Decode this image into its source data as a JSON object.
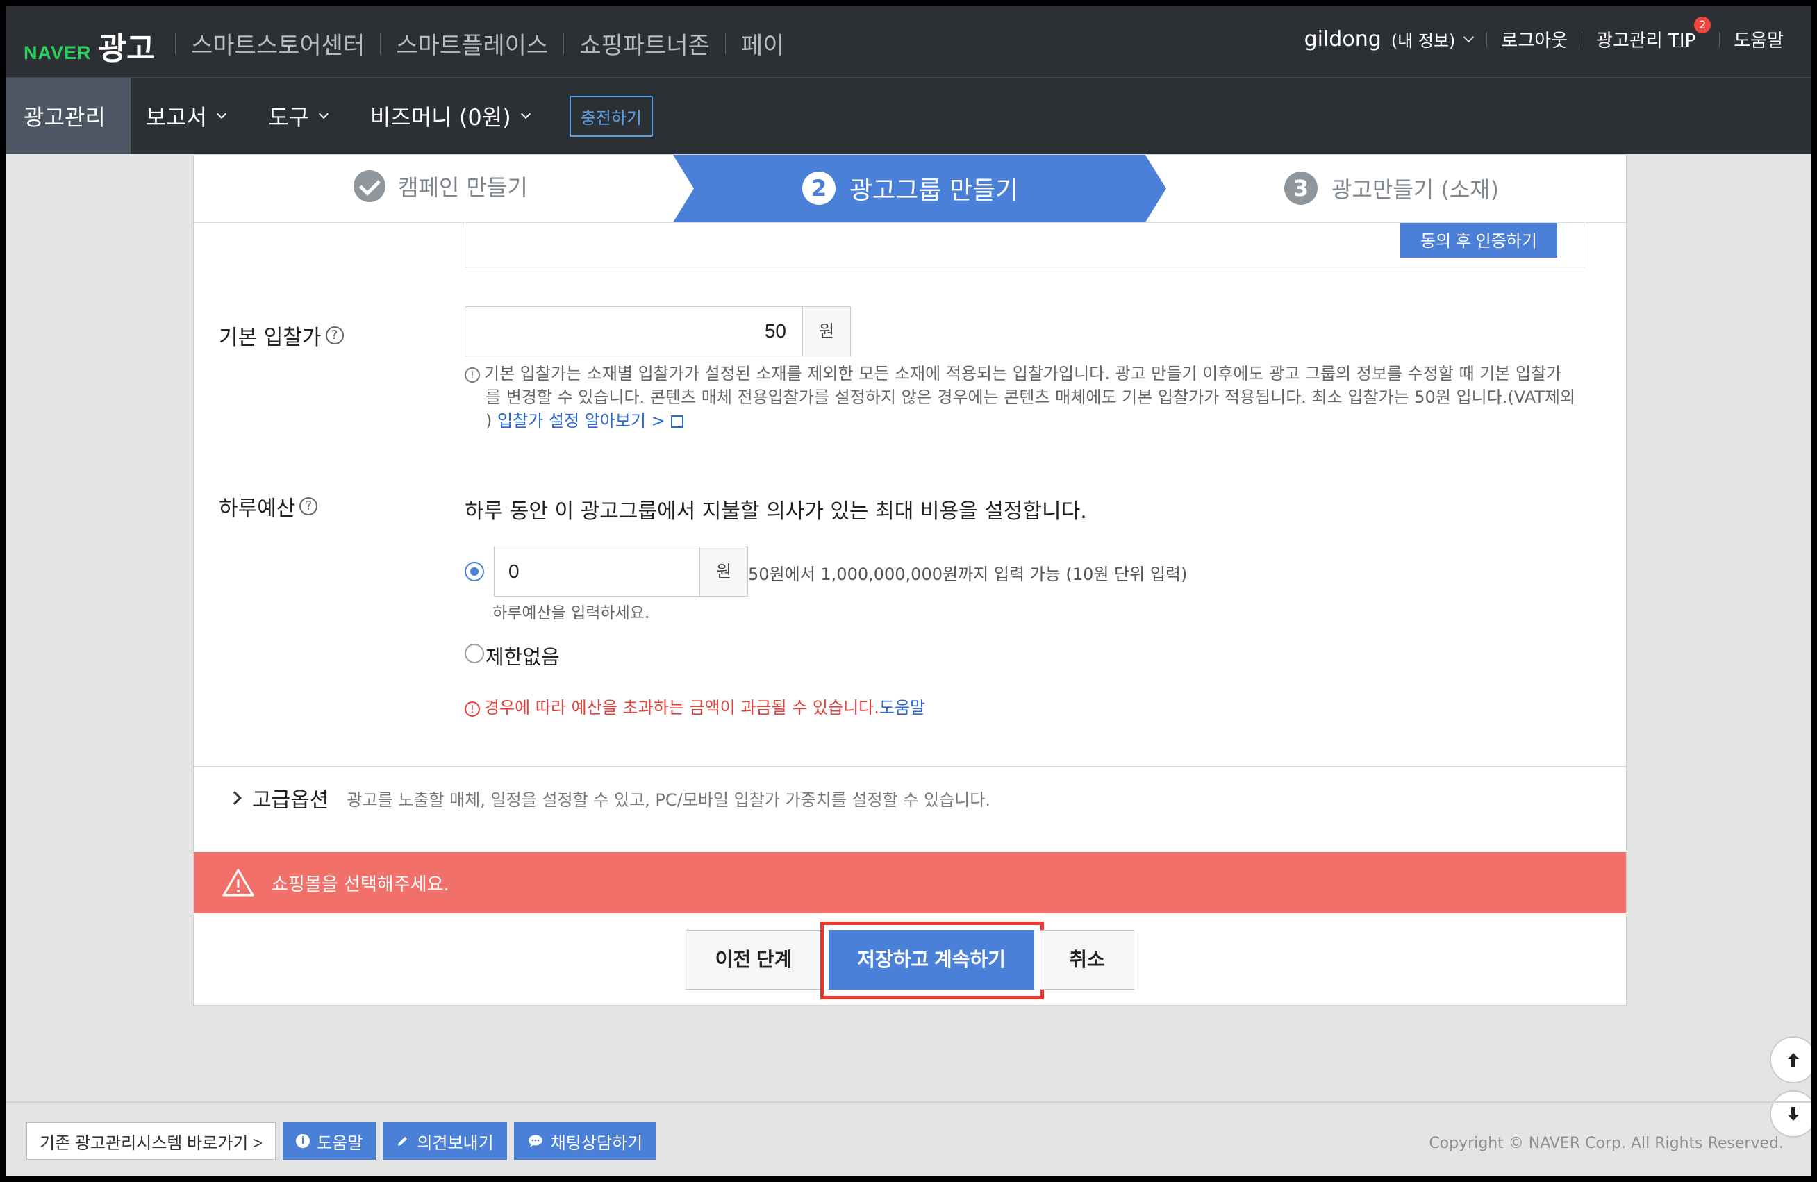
{
  "brand": {
    "naver": "NAVER",
    "ad": "광고"
  },
  "top_nav": [
    "스마트스토어센터",
    "스마트플레이스",
    "쇼핑파트너존",
    "페이"
  ],
  "user": {
    "name": "gildong",
    "info": "(내 정보)"
  },
  "top_links": {
    "logout": "로그아웃",
    "tip": "광고관리 TIP",
    "tip_badge": "2",
    "help": "도움말"
  },
  "sub_nav": {
    "items": [
      "광고관리",
      "보고서",
      "도구",
      "비즈머니 (0원)"
    ],
    "charge": "충전하기"
  },
  "steps": [
    {
      "label": "캠페인 만들기",
      "state": "done"
    },
    {
      "num": "2",
      "label": "광고그룹 만들기",
      "state": "active"
    },
    {
      "num": "3",
      "label": "광고만들기 (소재)",
      "state": "pending"
    }
  ],
  "cert_button": "동의 후 인증하기",
  "bid": {
    "label": "기본 입찰가",
    "help_icon": "?",
    "value": "50",
    "unit": "원",
    "note_line1": "기본 입찰가는 소재별 입찰가가 설정된 소재를 제외한 모든 소재에 적용되는 입찰가입니다. 광고 만들기 이후에도 광고 그룹의 정보를 수정할 때 기본 입찰가",
    "note_line2": "를 변경할 수 있습니다. 콘텐츠 매체 전용입찰가를 설정하지 않은 경우에는 콘텐츠 매체에도 기본 입찰가가 적용됩니다. 최소 입찰가는 50원 입니다.(VAT제외",
    "note_line3_prefix": ")",
    "note_link": "입찰가 설정 알아보기 >"
  },
  "budget": {
    "label": "하루예산",
    "description": "하루 동안 이 광고그룹에서 지불할 의사가 있는 최대 비용을 설정합니다.",
    "value": "0",
    "unit": "원",
    "range_hint": "50원에서 1,000,000,000원까지 입력 가능 (10원 단위 입력)",
    "input_help": "하루예산을 입력하세요.",
    "no_limit": "제한없음",
    "warning": "경우에 따라 예산을 초과하는 금액이 과금될 수 있습니다.",
    "warning_link": "도움말"
  },
  "advanced": {
    "title": "고급옵션",
    "description": "광고를 노출할 매체, 일정을 설정할 수 있고, PC/모바일 입찰가 가중치를 설정할 수 있습니다."
  },
  "error_message": "쇼핑몰을 선택해주세요.",
  "buttons": {
    "prev": "이전 단계",
    "save": "저장하고 계속하기",
    "cancel": "취소"
  },
  "footer": {
    "legacy": "기존 광고관리시스템 바로가기 >",
    "help": "도움말",
    "feedback": "의견보내기",
    "chat": "채팅상담하기",
    "copyright": "Copyright © NAVER Corp. All Rights Reserved."
  },
  "colors": {
    "accent": "#4a80d8",
    "error_bar": "#f1716a",
    "highlight": "#e8382f",
    "naver_green": "#2bd15e"
  }
}
